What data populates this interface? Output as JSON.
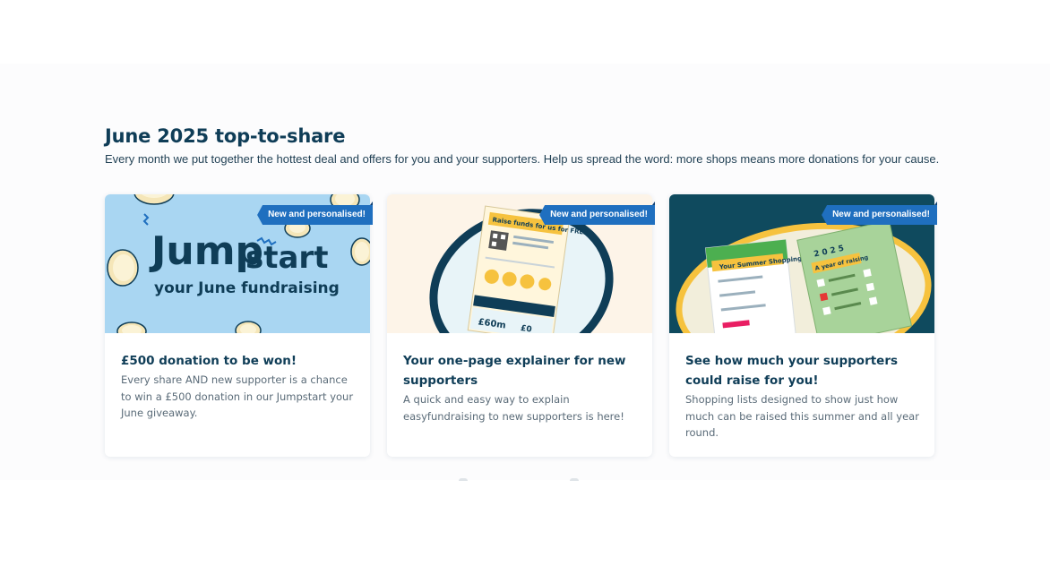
{
  "section": {
    "heading": "June 2025 top-to-share",
    "subheading": "Every month we put together the hottest deal and offers for you and your supporters. Help us spread the word: more shops means more donations for your cause."
  },
  "cards": [
    {
      "badge": "New and personalised!",
      "title": "£500 donation to be won!",
      "description": "Every share AND new supporter is a chance to win a £500 donation in our Jumpstart your June giveaway.",
      "art": {
        "headline_1": "Jump",
        "headline_2": "start",
        "tagline": "your June fundraising",
        "background": "#a9d6f2",
        "text_color": "#0f3d57"
      }
    },
    {
      "badge": "New and personalised!",
      "title": "Your one-page explainer for new supporters",
      "description": "A quick and easy way to explain easyfundraising to new supporters is here!",
      "art": {
        "flyer_heading": "Raise funds for us for FREE",
        "flyer_amount": "£60m",
        "flyer_zero": "£0",
        "background": "#fdf4e8"
      }
    },
    {
      "badge": "New and personalised!",
      "title": "See how much your supporters could raise for you!",
      "description": "Shopping lists designed to show just how much can be raised this summer and all year round.",
      "art": {
        "list_heading": "Your Summer Shopping",
        "year": "2025",
        "year_banner": "A year of raising",
        "background": "#0f4a5e"
      }
    }
  ],
  "colors": {
    "heading": "#0f3d57",
    "badge": "#1f6fbf",
    "section_bg": "#fcfcfd"
  }
}
